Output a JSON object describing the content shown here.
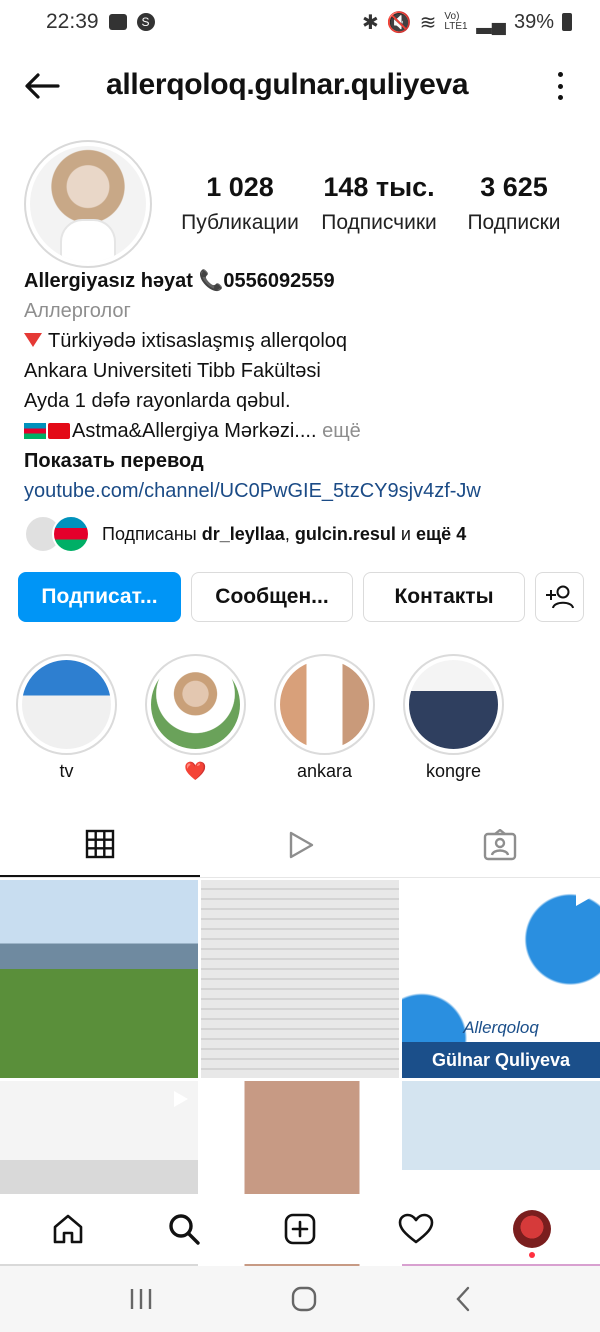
{
  "status_bar": {
    "time": "22:39",
    "network": "Vo) LTE1",
    "battery": "39%"
  },
  "header": {
    "username": "allerqoloq.gulnar.quliyeva"
  },
  "stats": {
    "posts_value": "1 028",
    "posts_label": "Публикации",
    "followers_value": "148 тыс.",
    "followers_label": "Подписчики",
    "following_value": "3 625",
    "following_label": "Подписки"
  },
  "bio": {
    "name": "Allergiyasız həyat 📞0556092559",
    "category": "Аллерголог",
    "line1": "Türkiyədə ixtisaslaşmış allerqoloq",
    "line2": "Ankara Universiteti Tibb Fakültəsi",
    "line3": "Ayda 1 dəfə rayonlarda qəbul.",
    "line4": "Astma&Allergiya Mərkəzi....",
    "more": "ещё",
    "translate": "Показать перевод",
    "link": "youtube.com/channel/UC0PwGIE_5tzCY9sjv4zf-Jw"
  },
  "followed_by": {
    "prefix": "Подписаны",
    "user1": "dr_leyllaa",
    "sep": ",",
    "user2": "gulcin.resul",
    "and": "и",
    "more": "ещё 4"
  },
  "buttons": {
    "follow": "Подписат...",
    "message": "Сообщен...",
    "contacts": "Контакты"
  },
  "highlights": [
    {
      "label": "tv"
    },
    {
      "label": "❤️"
    },
    {
      "label": "ankara"
    },
    {
      "label": "kongre"
    }
  ],
  "grid": {
    "post3_sub": "Allerqoloq",
    "post3_caption": "Gülnar Quliyeva"
  },
  "colors": {
    "accent": "#0095f6",
    "link": "#1b4b86",
    "muted": "#8e8e8e"
  }
}
